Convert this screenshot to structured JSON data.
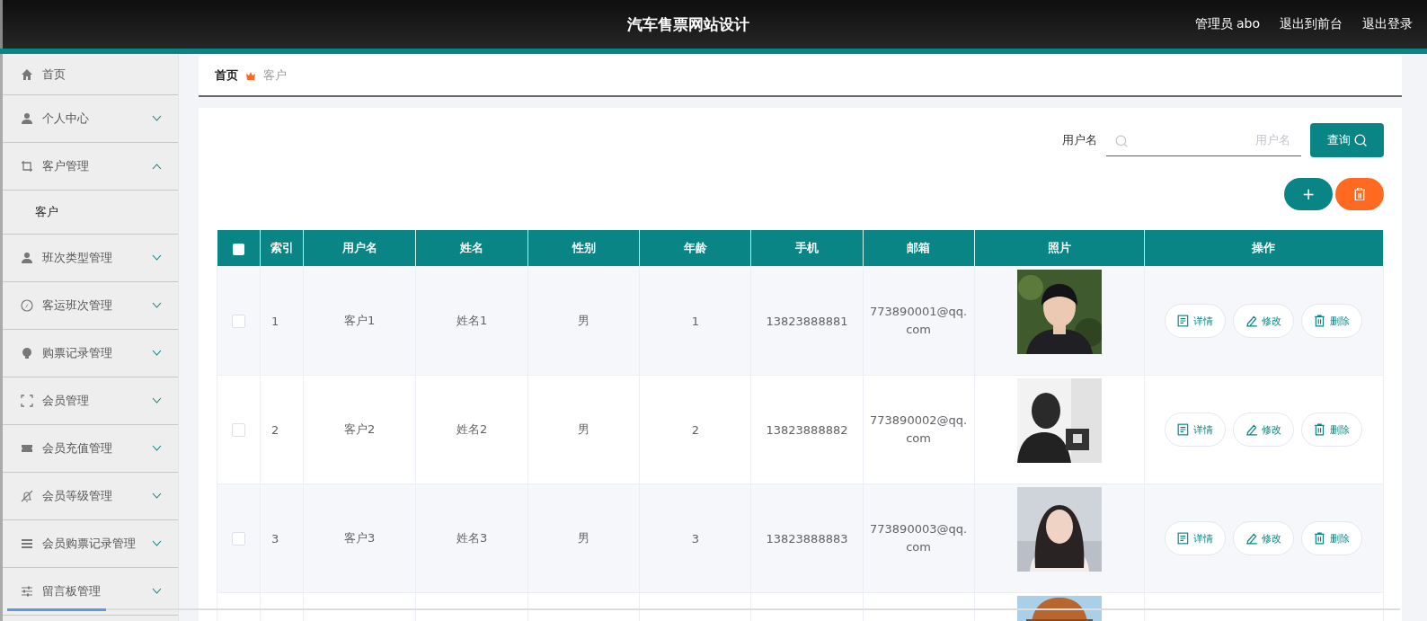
{
  "header": {
    "title": "汽车售票网站设计",
    "links": [
      "管理员 abo",
      "退出到前台",
      "退出登录"
    ]
  },
  "sidebar": {
    "items": [
      {
        "label": "首页"
      },
      {
        "label": "个人中心",
        "expanded": false
      },
      {
        "label": "客户管理",
        "expanded": true,
        "children": [
          {
            "label": "客户",
            "selected": true
          }
        ]
      },
      {
        "label": "班次类型管理",
        "expanded": false
      },
      {
        "label": "客运班次管理",
        "expanded": false
      },
      {
        "label": "购票记录管理",
        "expanded": false
      },
      {
        "label": "会员管理",
        "expanded": false
      },
      {
        "label": "会员充值管理",
        "expanded": false
      },
      {
        "label": "会员等级管理",
        "expanded": false
      },
      {
        "label": "会员购票记录管理",
        "expanded": false
      },
      {
        "label": "留言板管理",
        "expanded": false
      }
    ]
  },
  "breadcrumb": [
    {
      "label": "首页",
      "current": false
    },
    {
      "label": "客户",
      "current": true
    }
  ],
  "search": {
    "label": "用户名",
    "placeholder": "用户名",
    "button": "查询"
  },
  "actions": {
    "add": "+"
  },
  "table": {
    "select_all": {
      "checked": false
    },
    "columns": [
      "索引",
      "用户名",
      "姓名",
      "性别",
      "年龄",
      "手机",
      "邮箱",
      "照片",
      "操作"
    ],
    "rows": [
      {
        "checked": false,
        "cells": [
          "1",
          "客户1",
          "姓名1",
          "男",
          "1",
          "13823888881",
          "773890001@qq.com"
        ],
        "photo": {
          "kind": "picture"
        },
        "buttons": [
          "详情",
          "修改",
          "删除"
        ]
      },
      {
        "checked": false,
        "cells": [
          "2",
          "客户2",
          "姓名2",
          "男",
          "2",
          "13823888882",
          "773890002@qq.com"
        ],
        "photo": {
          "kind": "picture"
        },
        "buttons": [
          "详情",
          "修改",
          "删除"
        ]
      },
      {
        "checked": false,
        "cells": [
          "3",
          "客户3",
          "姓名3",
          "男",
          "3",
          "13823888883",
          "773890003@qq.com"
        ],
        "photo": {
          "kind": "picture"
        },
        "buttons": [
          "详情",
          "修改",
          "删除"
        ]
      },
      {
        "photo": {
          "kind": "picture"
        }
      }
    ]
  }
}
